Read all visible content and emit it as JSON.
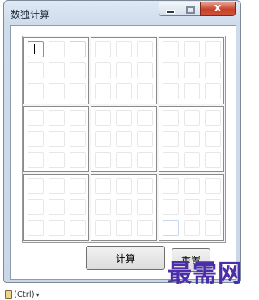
{
  "window": {
    "title": "数独计算",
    "close_glyph": "x"
  },
  "grid": {
    "rows": 9,
    "cols": 9,
    "focused_cell": [
      0,
      0
    ],
    "values": [
      [
        "",
        "",
        "",
        "",
        "",
        "",
        "",
        "",
        ""
      ],
      [
        "",
        "",
        "",
        "",
        "",
        "",
        "",
        "",
        ""
      ],
      [
        "",
        "",
        "",
        "",
        "",
        "",
        "",
        "",
        ""
      ],
      [
        "",
        "",
        "",
        "",
        "",
        "",
        "",
        "",
        ""
      ],
      [
        "",
        "",
        "",
        "",
        "",
        "",
        "",
        "",
        ""
      ],
      [
        "",
        "",
        "",
        "",
        "",
        "",
        "",
        "",
        ""
      ],
      [
        "",
        "",
        "",
        "",
        "",
        "",
        "",
        "",
        ""
      ],
      [
        "",
        "",
        "",
        "",
        "",
        "",
        "",
        "",
        ""
      ],
      [
        "",
        "",
        "",
        "",
        "",
        "",
        "",
        "",
        ""
      ]
    ]
  },
  "buttons": {
    "calculate_label": "计算",
    "reset_label": "重置"
  },
  "watermark": "最需网",
  "paste_badge": {
    "label": "(Ctrl)",
    "dropdown_glyph": "▾"
  },
  "colors": {
    "title_bar": "#cfdceb",
    "close_button": "#c7412a",
    "watermark": "#4b2ea8",
    "focus_border": "#6a9ac6"
  }
}
